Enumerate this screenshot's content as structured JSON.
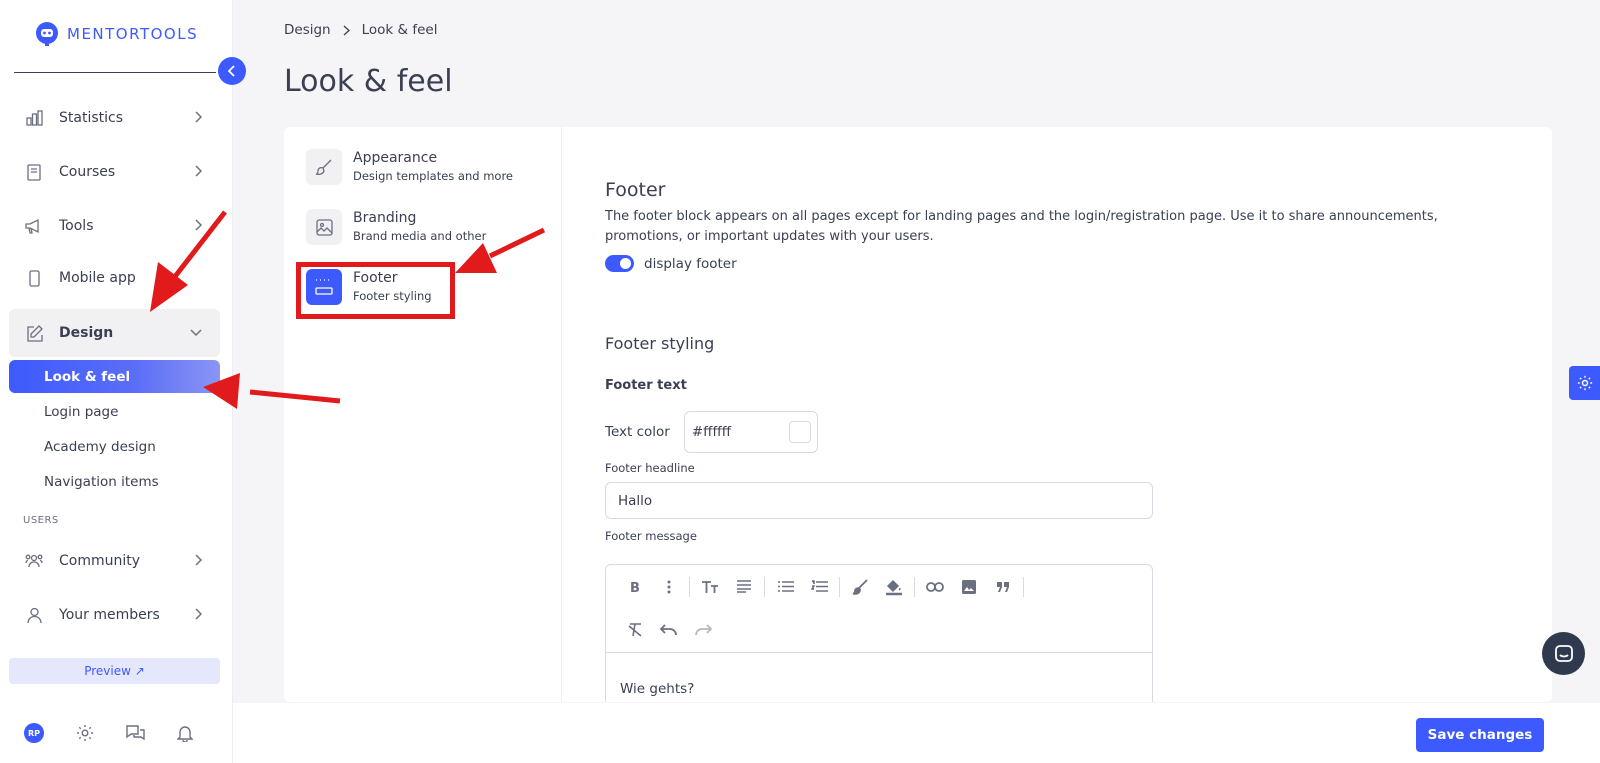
{
  "brand": {
    "name": "MENTORTOOLS",
    "accent": "#3d5afe"
  },
  "sidebar": {
    "items": [
      {
        "label": "Statistics",
        "icon": "bar-chart-icon"
      },
      {
        "label": "Courses",
        "icon": "book-icon"
      },
      {
        "label": "Tools",
        "icon": "megaphone-icon"
      },
      {
        "label": "Mobile app",
        "icon": "phone-icon"
      },
      {
        "label": "Design",
        "icon": "pencil-icon"
      }
    ],
    "design_sub": [
      "Look & feel",
      "Login page",
      "Academy design",
      "Navigation items"
    ],
    "users_label": "USERS",
    "user_items": [
      {
        "label": "Community",
        "icon": "community-icon"
      },
      {
        "label": "Your members",
        "icon": "user-icon"
      }
    ],
    "preview_label": "Preview ↗",
    "avatar_initials": "RP"
  },
  "breadcrumb": {
    "parent": "Design",
    "current": "Look & feel"
  },
  "page_title": "Look & feel",
  "submenu": [
    {
      "title": "Appearance",
      "subtitle": "Design templates and more",
      "icon": "brush-icon"
    },
    {
      "title": "Branding",
      "subtitle": "Brand media and other",
      "icon": "image-icon"
    },
    {
      "title": "Footer",
      "subtitle": "Footer styling",
      "icon": "footer-icon"
    }
  ],
  "footer_section": {
    "title": "Footer",
    "description": "The footer block appears on all pages except for landing pages and the login/registration page. Use it to share announcements, promotions, or important updates with your users.",
    "toggle_label": "display footer",
    "styling_title": "Footer styling",
    "footer_text_label": "Footer text",
    "text_color_label": "Text color",
    "text_color_value": "#ffffff",
    "headline_label": "Footer headline",
    "headline_value": "Hallo",
    "message_label": "Footer message",
    "message_value": "Wie gehts?"
  },
  "save_label": "Save changes",
  "annotation_color": "#e11b1b"
}
